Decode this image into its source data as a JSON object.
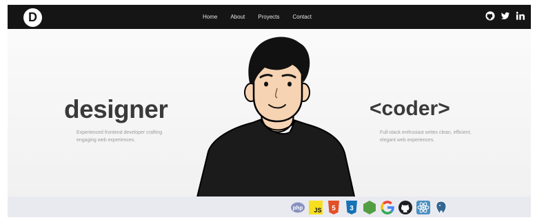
{
  "logo": {
    "letter": "D"
  },
  "nav": {
    "items": [
      "Home",
      "About",
      "Proyects",
      "Contact"
    ]
  },
  "social": [
    "github-icon",
    "twitter-icon",
    "linkedin-icon"
  ],
  "hero": {
    "left_heading": "designer",
    "left_subtitle": "Experienced frontend developer crafting engaging web experiences.",
    "right_heading": "<coder>",
    "right_subtitle": "Full-stack enthusiast writes clean, efficient, elegant web experiences."
  },
  "tech_stack": {
    "icons": [
      "php-icon",
      "javascript-icon",
      "html5-icon",
      "css3-icon",
      "nodejs-icon",
      "google-icon",
      "github-icon",
      "react-icon",
      "postgresql-icon"
    ],
    "php_text": "php",
    "js_text": "JS",
    "html_text": "5",
    "css_text": "3",
    "google_text": "G"
  },
  "colors": {
    "navbar": "#151515",
    "heading": "#3a3a3a",
    "subtitle": "#9a9a9a",
    "php": "#8892bf",
    "javascript": "#f7df1e",
    "html5": "#e34f26",
    "css3": "#1572b6",
    "nodejs": "#539e43",
    "react": "#61dafb",
    "postgresql": "#336791",
    "shirt": "#1b1b1b",
    "skin": "#f6d3b3",
    "hair": "#111111"
  }
}
